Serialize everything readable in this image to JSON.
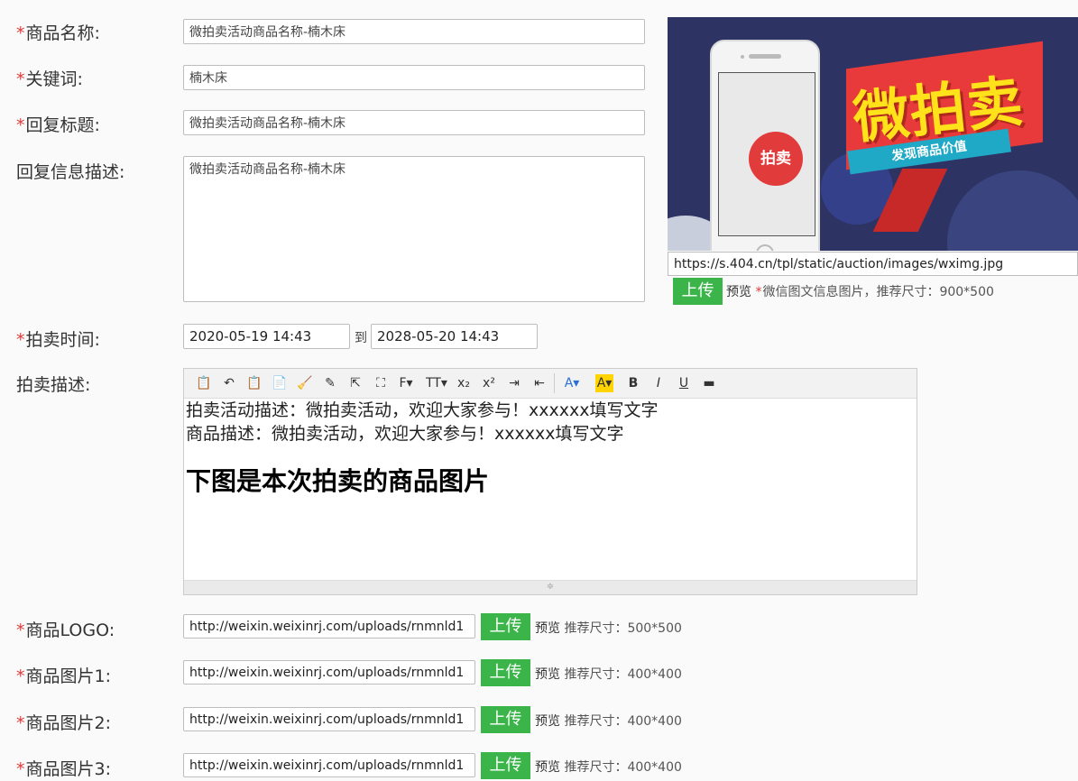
{
  "form": {
    "req_mark": "*",
    "name_label": "商品名称:",
    "name_value": "微拍卖活动商品名称-楠木床",
    "keyword_label": "关键词:",
    "keyword_value": "楠木床",
    "reply_title_label": "回复标题:",
    "reply_title_value": "微拍卖活动商品名称-楠木床",
    "reply_desc_label": "回复信息描述:",
    "reply_desc_value": "微拍卖活动商品名称-楠木床",
    "time_label": "拍卖时间:",
    "time_start": "2020-05-19 14:43",
    "time_to": "到",
    "time_end": "2028-05-20 14:43",
    "auction_desc_label": "拍卖描述:"
  },
  "banner": {
    "badge": "拍卖",
    "title": "微拍卖",
    "tagline": "发现商品价值",
    "url": "https://s.404.cn/tpl/static/auction/images/wximg.jpg",
    "upload_label": "上传",
    "preview_label": "预览",
    "hint": "微信图文信息图片，推荐尺寸：900*500"
  },
  "editor": {
    "line1": "拍卖活动描述：微拍卖活动，欢迎大家参与！xxxxxx填写文字",
    "line2": "商品描述：微拍卖活动，欢迎大家参与！xxxxxx填写文字",
    "heading": "下图是本次拍卖的商品图片",
    "resize_glyph": "≑",
    "toolbar": [
      {
        "name": "source-icon",
        "glyph": "📋"
      },
      {
        "name": "undo-icon",
        "glyph": "↶"
      },
      {
        "name": "paste-icon",
        "glyph": "📋"
      },
      {
        "name": "paste-word-icon",
        "glyph": "📄"
      },
      {
        "name": "clear-format-icon",
        "glyph": "🧹"
      },
      {
        "name": "format-painter-icon",
        "glyph": "✎"
      },
      {
        "name": "select-all-icon",
        "glyph": "⇱"
      },
      {
        "name": "fullscreen-icon",
        "glyph": "⛶"
      },
      {
        "name": "font-family-icon",
        "glyph": "F▾"
      },
      {
        "name": "font-size-icon",
        "glyph": "TT▾"
      },
      {
        "name": "subscript-icon",
        "glyph": "x₂"
      },
      {
        "name": "superscript-icon",
        "glyph": "x²"
      },
      {
        "name": "indent-icon",
        "glyph": "⇥"
      },
      {
        "name": "outdent-icon",
        "glyph": "⇤"
      },
      {
        "name": "font-color-icon",
        "glyph": "A▾"
      },
      {
        "name": "highlight-color-icon",
        "glyph": "A▾"
      },
      {
        "name": "bold-icon",
        "glyph": "B"
      },
      {
        "name": "italic-icon",
        "glyph": "I"
      },
      {
        "name": "underline-icon",
        "glyph": "U"
      },
      {
        "name": "insert-hr-icon",
        "glyph": "▬"
      }
    ]
  },
  "uploads": [
    {
      "label": "商品LOGO:",
      "url": "http://weixin.weixinrj.com/uploads/rnmnld1",
      "button": "上传",
      "preview": "预览",
      "hint": "推荐尺寸：500*500"
    },
    {
      "label": "商品图片1:",
      "url": "http://weixin.weixinrj.com/uploads/rnmnld1",
      "button": "上传",
      "preview": "预览",
      "hint": "推荐尺寸：400*400"
    },
    {
      "label": "商品图片2:",
      "url": "http://weixin.weixinrj.com/uploads/rnmnld1",
      "button": "上传",
      "preview": "预览",
      "hint": "推荐尺寸：400*400"
    },
    {
      "label": "商品图片3:",
      "url": "http://weixin.weixinrj.com/uploads/rnmnld1",
      "button": "上传",
      "preview": "预览",
      "hint": "推荐尺寸：400*400"
    }
  ],
  "colors": {
    "required": "#e03a3a",
    "upload_button": "#3bb54a",
    "banner_bg": "#2d3463"
  }
}
